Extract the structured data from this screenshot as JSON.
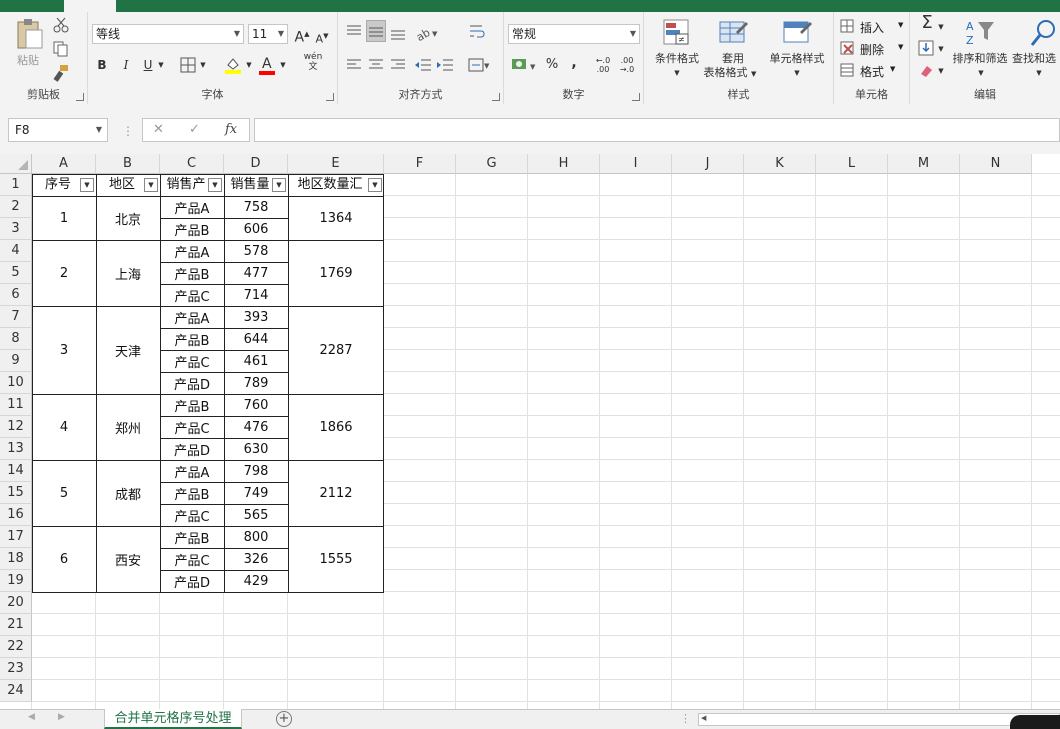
{
  "ribbon": {
    "clipboard": {
      "paste_label": "粘贴",
      "group_label": "剪贴板"
    },
    "font": {
      "font_name": "等线",
      "font_size": "11",
      "bold": "B",
      "italic": "I",
      "underline": "U",
      "phonetic_label": "wén",
      "group_label": "字体",
      "font_color": "#ff0000",
      "fill_color": "#ffff00"
    },
    "alignment": {
      "group_label": "对齐方式"
    },
    "number": {
      "format": "常规",
      "percent": "%",
      "comma": ",",
      "inc_decimal": ".00",
      "dec_decimal": ".0",
      "group_label": "数字"
    },
    "styles": {
      "conditional": "条件格式",
      "table_format_line1": "套用",
      "table_format_line2": "表格格式",
      "cell_styles": "单元格样式",
      "group_label": "样式"
    },
    "cells": {
      "insert": "插入",
      "delete": "删除",
      "format": "格式",
      "group_label": "单元格"
    },
    "editing": {
      "sum_icon": "Σ",
      "sort_filter": "排序和筛选",
      "find_select": "查找和选",
      "group_label": "编辑"
    }
  },
  "formula_bar": {
    "name_box": "F8",
    "cancel": "✕",
    "enter": "✓",
    "fx": "fx",
    "value": ""
  },
  "columns": [
    "A",
    "B",
    "C",
    "D",
    "E",
    "F",
    "G",
    "H",
    "I",
    "J",
    "K",
    "L",
    "M",
    "N"
  ],
  "rows": [
    "1",
    "2",
    "3",
    "4",
    "5",
    "6",
    "7",
    "8",
    "9",
    "10",
    "11",
    "12",
    "13",
    "14",
    "15",
    "16",
    "17",
    "18",
    "19",
    "20",
    "21",
    "22",
    "23",
    "24"
  ],
  "table": {
    "headers": [
      "序号",
      "地区",
      "销售产",
      "销售量",
      "地区数量汇"
    ],
    "groups": [
      {
        "seq": "1",
        "region": "北京",
        "total": "1364",
        "items": [
          [
            "产品A",
            "758"
          ],
          [
            "产品B",
            "606"
          ]
        ]
      },
      {
        "seq": "2",
        "region": "上海",
        "total": "1769",
        "items": [
          [
            "产品A",
            "578"
          ],
          [
            "产品B",
            "477"
          ],
          [
            "产品C",
            "714"
          ]
        ]
      },
      {
        "seq": "3",
        "region": "天津",
        "total": "2287",
        "items": [
          [
            "产品A",
            "393"
          ],
          [
            "产品B",
            "644"
          ],
          [
            "产品C",
            "461"
          ],
          [
            "产品D",
            "789"
          ]
        ]
      },
      {
        "seq": "4",
        "region": "郑州",
        "total": "1866",
        "items": [
          [
            "产品B",
            "760"
          ],
          [
            "产品C",
            "476"
          ],
          [
            "产品D",
            "630"
          ]
        ]
      },
      {
        "seq": "5",
        "region": "成都",
        "total": "2112",
        "items": [
          [
            "产品A",
            "798"
          ],
          [
            "产品B",
            "749"
          ],
          [
            "产品C",
            "565"
          ]
        ]
      },
      {
        "seq": "6",
        "region": "西安",
        "total": "1555",
        "items": [
          [
            "产品B",
            "800"
          ],
          [
            "产品C",
            "326"
          ],
          [
            "产品D",
            "429"
          ]
        ]
      }
    ]
  },
  "sheet_tab": {
    "name": "合并单元格序号处理",
    "add": "+"
  }
}
